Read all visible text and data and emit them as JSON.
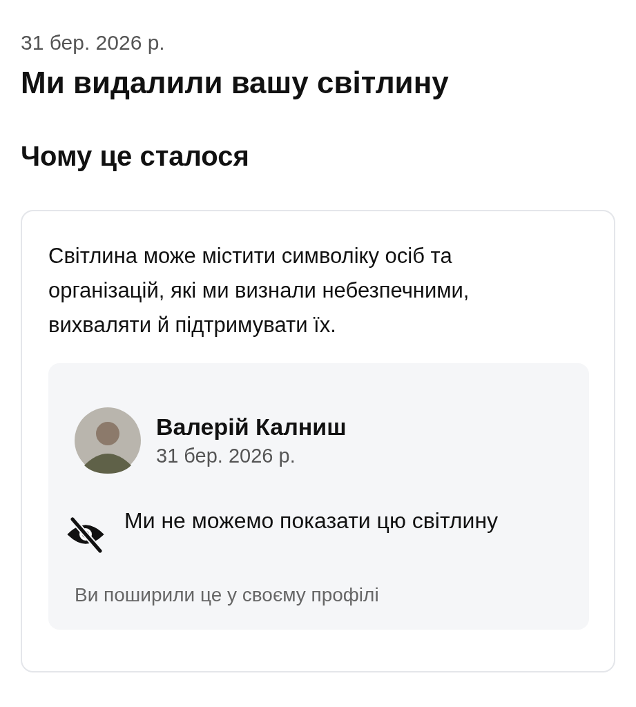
{
  "date": "31 бер. 2026 р.",
  "title": "Ми видалили вашу світлину",
  "section_heading": "Чому це сталося",
  "card": {
    "reason": "Світлина може містити символіку осіб та організацій, які ми визнали небезпечними, вихваляти й підтримувати їх.",
    "post": {
      "author": "Валерій Калниш",
      "date": "31 бер. 2026 р.",
      "notice": "Ми не можемо показати цю світлину",
      "footer": "Ви поширили це у своєму профілі"
    }
  }
}
